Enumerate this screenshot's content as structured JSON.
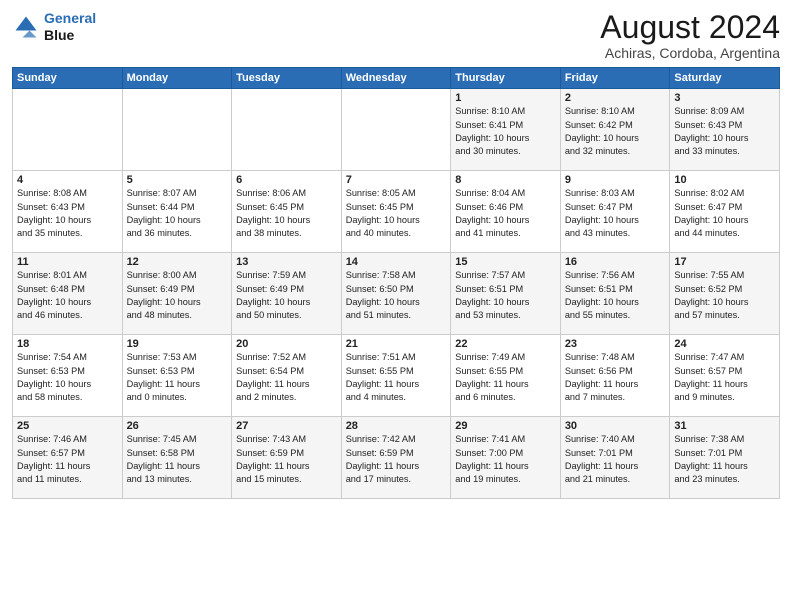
{
  "header": {
    "logo_line1": "General",
    "logo_line2": "Blue",
    "title": "August 2024",
    "subtitle": "Achiras, Cordoba, Argentina"
  },
  "days_of_week": [
    "Sunday",
    "Monday",
    "Tuesday",
    "Wednesday",
    "Thursday",
    "Friday",
    "Saturday"
  ],
  "weeks": [
    [
      {
        "day": "",
        "info": ""
      },
      {
        "day": "",
        "info": ""
      },
      {
        "day": "",
        "info": ""
      },
      {
        "day": "",
        "info": ""
      },
      {
        "day": "1",
        "info": "Sunrise: 8:10 AM\nSunset: 6:41 PM\nDaylight: 10 hours\nand 30 minutes."
      },
      {
        "day": "2",
        "info": "Sunrise: 8:10 AM\nSunset: 6:42 PM\nDaylight: 10 hours\nand 32 minutes."
      },
      {
        "day": "3",
        "info": "Sunrise: 8:09 AM\nSunset: 6:43 PM\nDaylight: 10 hours\nand 33 minutes."
      }
    ],
    [
      {
        "day": "4",
        "info": "Sunrise: 8:08 AM\nSunset: 6:43 PM\nDaylight: 10 hours\nand 35 minutes."
      },
      {
        "day": "5",
        "info": "Sunrise: 8:07 AM\nSunset: 6:44 PM\nDaylight: 10 hours\nand 36 minutes."
      },
      {
        "day": "6",
        "info": "Sunrise: 8:06 AM\nSunset: 6:45 PM\nDaylight: 10 hours\nand 38 minutes."
      },
      {
        "day": "7",
        "info": "Sunrise: 8:05 AM\nSunset: 6:45 PM\nDaylight: 10 hours\nand 40 minutes."
      },
      {
        "day": "8",
        "info": "Sunrise: 8:04 AM\nSunset: 6:46 PM\nDaylight: 10 hours\nand 41 minutes."
      },
      {
        "day": "9",
        "info": "Sunrise: 8:03 AM\nSunset: 6:47 PM\nDaylight: 10 hours\nand 43 minutes."
      },
      {
        "day": "10",
        "info": "Sunrise: 8:02 AM\nSunset: 6:47 PM\nDaylight: 10 hours\nand 44 minutes."
      }
    ],
    [
      {
        "day": "11",
        "info": "Sunrise: 8:01 AM\nSunset: 6:48 PM\nDaylight: 10 hours\nand 46 minutes."
      },
      {
        "day": "12",
        "info": "Sunrise: 8:00 AM\nSunset: 6:49 PM\nDaylight: 10 hours\nand 48 minutes."
      },
      {
        "day": "13",
        "info": "Sunrise: 7:59 AM\nSunset: 6:49 PM\nDaylight: 10 hours\nand 50 minutes."
      },
      {
        "day": "14",
        "info": "Sunrise: 7:58 AM\nSunset: 6:50 PM\nDaylight: 10 hours\nand 51 minutes."
      },
      {
        "day": "15",
        "info": "Sunrise: 7:57 AM\nSunset: 6:51 PM\nDaylight: 10 hours\nand 53 minutes."
      },
      {
        "day": "16",
        "info": "Sunrise: 7:56 AM\nSunset: 6:51 PM\nDaylight: 10 hours\nand 55 minutes."
      },
      {
        "day": "17",
        "info": "Sunrise: 7:55 AM\nSunset: 6:52 PM\nDaylight: 10 hours\nand 57 minutes."
      }
    ],
    [
      {
        "day": "18",
        "info": "Sunrise: 7:54 AM\nSunset: 6:53 PM\nDaylight: 10 hours\nand 58 minutes."
      },
      {
        "day": "19",
        "info": "Sunrise: 7:53 AM\nSunset: 6:53 PM\nDaylight: 11 hours\nand 0 minutes."
      },
      {
        "day": "20",
        "info": "Sunrise: 7:52 AM\nSunset: 6:54 PM\nDaylight: 11 hours\nand 2 minutes."
      },
      {
        "day": "21",
        "info": "Sunrise: 7:51 AM\nSunset: 6:55 PM\nDaylight: 11 hours\nand 4 minutes."
      },
      {
        "day": "22",
        "info": "Sunrise: 7:49 AM\nSunset: 6:55 PM\nDaylight: 11 hours\nand 6 minutes."
      },
      {
        "day": "23",
        "info": "Sunrise: 7:48 AM\nSunset: 6:56 PM\nDaylight: 11 hours\nand 7 minutes."
      },
      {
        "day": "24",
        "info": "Sunrise: 7:47 AM\nSunset: 6:57 PM\nDaylight: 11 hours\nand 9 minutes."
      }
    ],
    [
      {
        "day": "25",
        "info": "Sunrise: 7:46 AM\nSunset: 6:57 PM\nDaylight: 11 hours\nand 11 minutes."
      },
      {
        "day": "26",
        "info": "Sunrise: 7:45 AM\nSunset: 6:58 PM\nDaylight: 11 hours\nand 13 minutes."
      },
      {
        "day": "27",
        "info": "Sunrise: 7:43 AM\nSunset: 6:59 PM\nDaylight: 11 hours\nand 15 minutes."
      },
      {
        "day": "28",
        "info": "Sunrise: 7:42 AM\nSunset: 6:59 PM\nDaylight: 11 hours\nand 17 minutes."
      },
      {
        "day": "29",
        "info": "Sunrise: 7:41 AM\nSunset: 7:00 PM\nDaylight: 11 hours\nand 19 minutes."
      },
      {
        "day": "30",
        "info": "Sunrise: 7:40 AM\nSunset: 7:01 PM\nDaylight: 11 hours\nand 21 minutes."
      },
      {
        "day": "31",
        "info": "Sunrise: 7:38 AM\nSunset: 7:01 PM\nDaylight: 11 hours\nand 23 minutes."
      }
    ]
  ]
}
